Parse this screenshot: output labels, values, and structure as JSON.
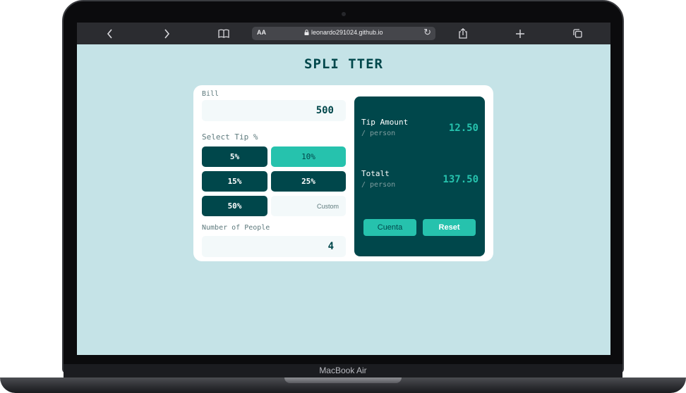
{
  "browser": {
    "text_size_label": "AA",
    "url": "leonardo291024.github.io",
    "icons": [
      "chevron-left-icon",
      "chevron-right-icon",
      "book-icon",
      "lock-icon",
      "reload-icon",
      "share-icon",
      "plus-icon",
      "tabs-icon"
    ]
  },
  "app": {
    "title": "SPLI TTER",
    "bill_label": "Bill",
    "bill_value": "500",
    "select_tip_label": "Select Tip %",
    "tips": [
      "5%",
      "10%",
      "15%",
      "25%",
      "50%"
    ],
    "active_tip": "10%",
    "custom_placeholder": "Custom",
    "people_label": "Number of People",
    "people_value": "4"
  },
  "result": {
    "tip_label": "Tip Amount",
    "tip_sub": "/ person",
    "tip_value": "12.50",
    "total_label": "Totalt",
    "total_sub": "/ person",
    "total_value": "137.50",
    "cuenta_label": "Cuenta",
    "reset_label": "Reset"
  },
  "device": {
    "model_label": "MacBook Air"
  },
  "colors": {
    "background": "#c5e3e7",
    "dark_cyan": "#00474b",
    "strong_cyan": "#26c2ad",
    "field_bg": "#f3f9fa"
  }
}
